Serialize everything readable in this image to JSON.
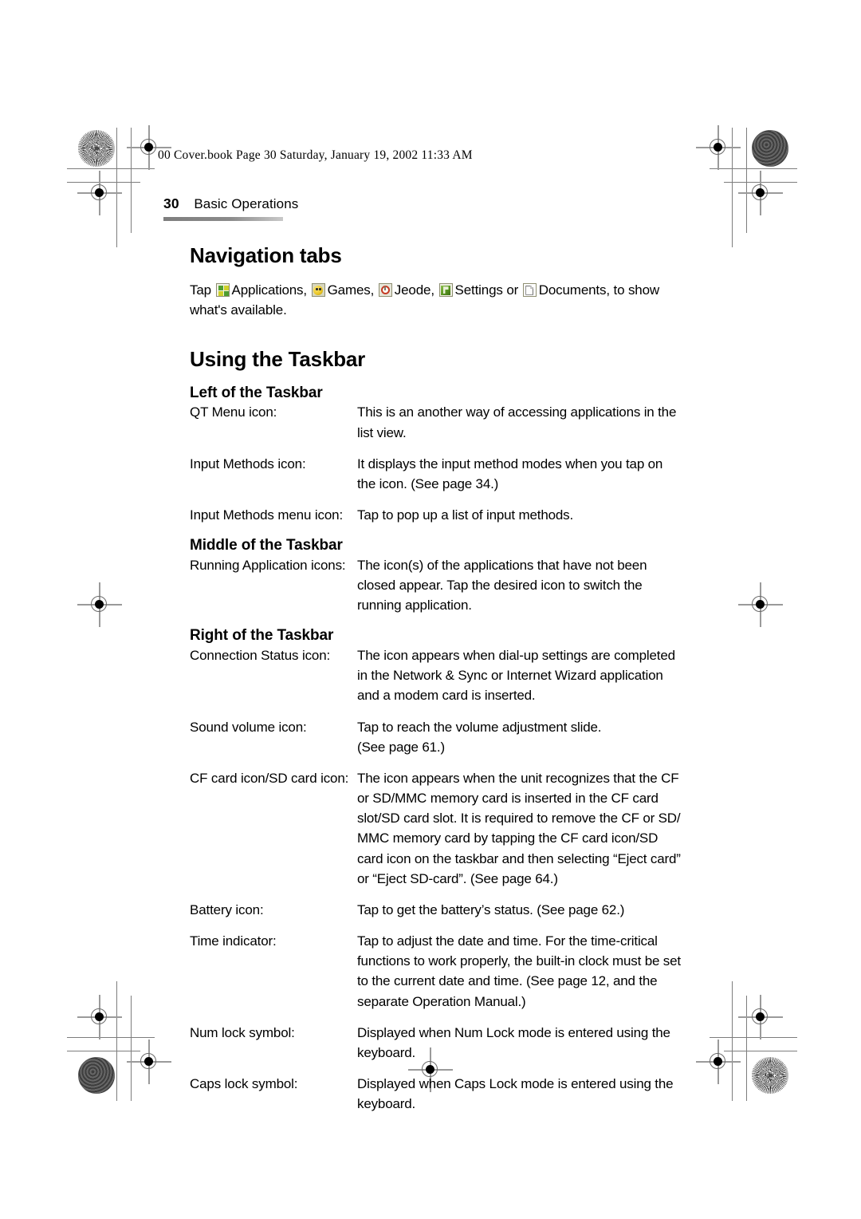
{
  "page": {
    "file_stamp": "00 Cover.book  Page 30  Saturday, January 19, 2002  11:33 AM",
    "folio": "30",
    "chapter": "Basic Operations"
  },
  "sections": {
    "navigation_tabs": {
      "heading": "Navigation tabs",
      "intro_prefix": "Tap ",
      "tabs": [
        {
          "icon": "applications-grid-icon",
          "label": "Applications,"
        },
        {
          "icon": "games-smiley-icon",
          "label": "Games,"
        },
        {
          "icon": "jeode-circle-icon",
          "label": "Jeode,"
        },
        {
          "icon": "settings-icon",
          "label": "Settings or"
        },
        {
          "icon": "documents-page-icon",
          "label": "Documents, to show"
        }
      ],
      "intro_suffix": "what's available."
    },
    "using_taskbar": {
      "heading": "Using the Taskbar",
      "groups": [
        {
          "title": "Left of the Taskbar",
          "rows": [
            {
              "term": "QT Menu icon:",
              "lines": [
                "This is an another way of accessing applications in the",
                "list view."
              ]
            },
            {
              "term": "Input Methods icon:",
              "lines": [
                "It displays the input method modes when you tap on",
                "the icon. (See page 34.)"
              ]
            },
            {
              "term": "Input Methods menu icon:",
              "lines": [
                "Tap to pop up a list of input methods."
              ]
            }
          ]
        },
        {
          "title": "Middle of the Taskbar",
          "rows": [
            {
              "term": "Running Application icons:",
              "lines": [
                "The icon(s) of the applications that have not been",
                "closed appear. Tap the desired icon to switch the",
                "running application."
              ]
            }
          ]
        },
        {
          "title": "Right of the Taskbar",
          "rows": [
            {
              "term": "Connection Status icon:",
              "lines": [
                "The icon appears when dial-up settings are completed",
                "in the Network & Sync or Internet Wizard application",
                "and a modem card is inserted."
              ]
            },
            {
              "term": "Sound volume icon:",
              "lines": [
                "Tap to reach the volume adjustment slide.",
                "(See page 61.)"
              ]
            },
            {
              "term": "CF card icon/SD card icon:",
              "lines": [
                "The icon appears when the unit recognizes that the CF",
                "or SD/MMC memory card is inserted in the CF card",
                "slot/SD card slot. It is required to remove the CF or SD/",
                "MMC memory card by tapping the CF card icon/SD",
                "card icon on the taskbar and then selecting “Eject card”",
                "or “Eject SD-card”. (See page 64.)"
              ]
            },
            {
              "term": "Battery icon:",
              "lines": [
                "Tap to get the battery’s status. (See page 62.)"
              ]
            },
            {
              "term": "Time indicator:",
              "lines": [
                "Tap to adjust the date and time. For the time-critical",
                "functions to work properly, the built-in clock must be set",
                "to the current date and time. (See page 12, and the",
                "separate Operation Manual.)"
              ]
            },
            {
              "term": "Num lock symbol:",
              "lines": [
                "Displayed when Num Lock mode is entered using the",
                "keyboard."
              ]
            },
            {
              "term": "Caps lock symbol:",
              "lines": [
                "Displayed when Caps Lock mode is entered using the",
                "keyboard."
              ]
            }
          ]
        }
      ]
    }
  }
}
